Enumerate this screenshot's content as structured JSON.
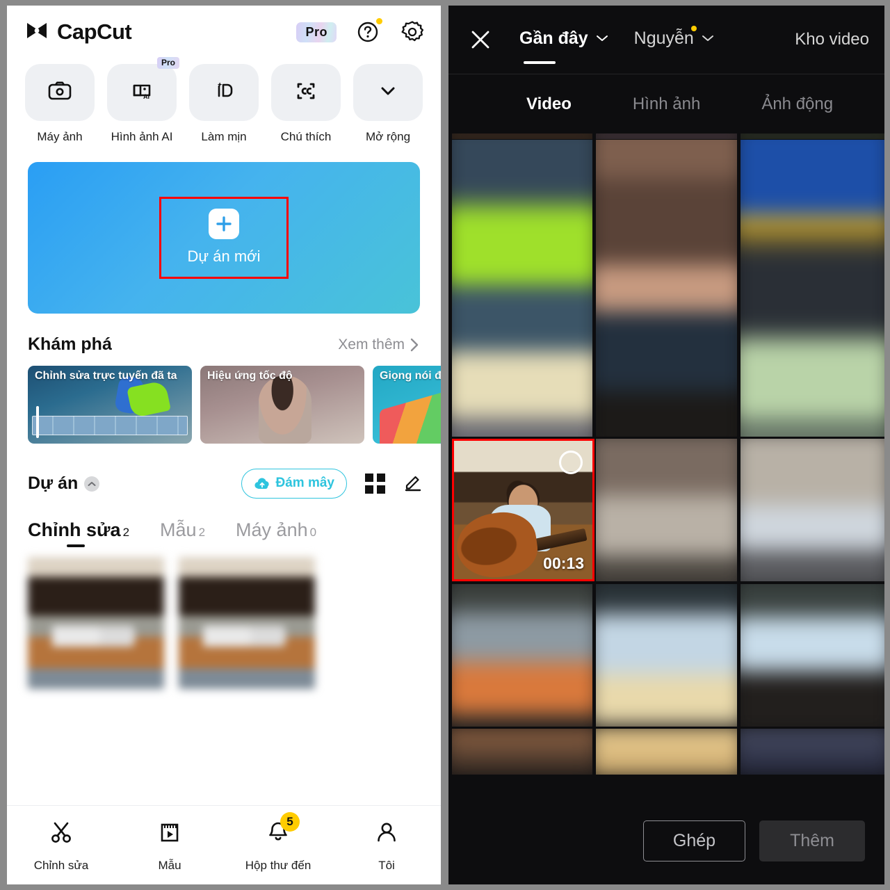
{
  "left": {
    "app_name": "CapCut",
    "pro_badge": "Pro",
    "quick_actions": [
      {
        "label": "Máy ảnh",
        "icon": "camera-icon",
        "pro": false
      },
      {
        "label": "Hình ảnh AI",
        "icon": "ai-image-icon",
        "pro": true,
        "pro_label": "Pro"
      },
      {
        "label": "Làm mịn",
        "icon": "retouch-icon",
        "pro": false
      },
      {
        "label": "Chú thích",
        "icon": "captions-icon",
        "pro": false
      },
      {
        "label": "Mở rộng",
        "icon": "chevron-down-icon",
        "pro": false
      }
    ],
    "new_project": {
      "label": "Dự án mới",
      "icon": "plus-icon"
    },
    "explore": {
      "title": "Khám phá",
      "see_more": "Xem thêm",
      "cards": [
        {
          "caption": "Chỉnh sửa trực tuyến đã ta"
        },
        {
          "caption": "Hiệu ứng tốc độ"
        },
        {
          "caption": "Giọng nói đ"
        }
      ]
    },
    "projects": {
      "title": "Dự án",
      "cloud_button": "Đám mây",
      "tabs": [
        {
          "label": "Chỉnh sửa",
          "count": "2",
          "active": true
        },
        {
          "label": "Mẫu",
          "count": "2",
          "active": false
        },
        {
          "label": "Máy ảnh",
          "count": "0",
          "active": false
        }
      ],
      "items": [
        {
          "name": "project-thumbnail-1"
        },
        {
          "name": "project-thumbnail-2"
        }
      ]
    },
    "bottom_nav": [
      {
        "label": "Chỉnh sửa",
        "icon": "scissors-icon",
        "badge": ""
      },
      {
        "label": "Mẫu",
        "icon": "template-icon",
        "badge": ""
      },
      {
        "label": "Hộp thư đến",
        "icon": "bell-icon",
        "badge": "5"
      },
      {
        "label": "Tôi",
        "icon": "person-icon",
        "badge": ""
      }
    ]
  },
  "right": {
    "close_icon": "close-icon",
    "source_tabs": [
      {
        "label": "Gần đây",
        "active": true,
        "has_caret": true,
        "has_dot": false
      },
      {
        "label": "Nguyễn",
        "active": false,
        "has_caret": true,
        "has_dot": true
      }
    ],
    "store_link": "Kho video",
    "media_tabs": [
      {
        "label": "Video",
        "active": true
      },
      {
        "label": "Hình ảnh",
        "active": false
      },
      {
        "label": "Ảnh động",
        "active": false
      }
    ],
    "selected_media": {
      "duration": "00:13",
      "name": "guitar-clip"
    },
    "footer": {
      "merge_button": "Ghép",
      "add_button": "Thêm"
    }
  },
  "colors": {
    "accent_cyan": "#2ec4de",
    "banner_blue": "#2a9ef4",
    "badge_yellow": "#ffcc00",
    "highlight_red": "#ff0000",
    "dark_bg": "#0d0d0f"
  }
}
